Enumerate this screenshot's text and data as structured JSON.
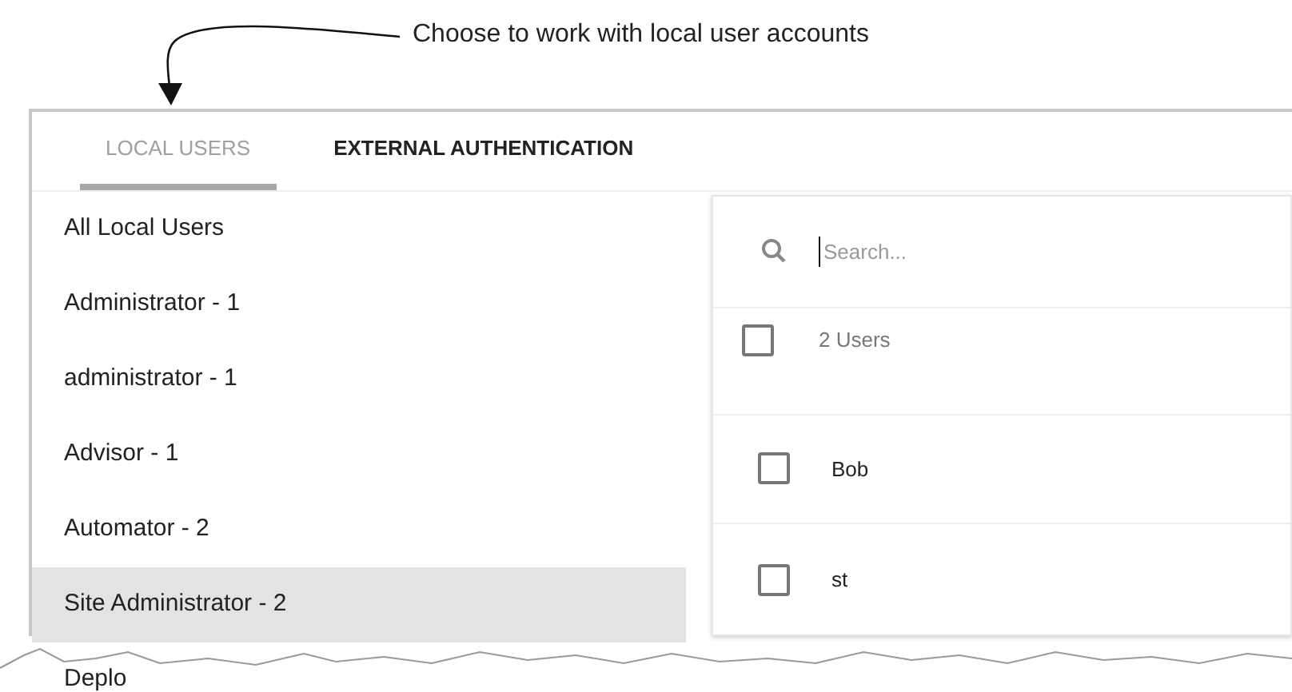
{
  "annotation": {
    "text": "Choose to work with local user accounts"
  },
  "tabs": [
    {
      "label": "LOCAL USERS",
      "selected": true
    },
    {
      "label": "EXTERNAL AUTHENTICATION",
      "selected": false
    }
  ],
  "groups": [
    {
      "label": "All Local Users",
      "selected": false
    },
    {
      "label": "Administrator - 1",
      "selected": false
    },
    {
      "label": "administrator - 1",
      "selected": false
    },
    {
      "label": "Advisor - 1",
      "selected": false
    },
    {
      "label": "Automator - 2",
      "selected": false
    },
    {
      "label": "Site Administrator - 2",
      "selected": true
    },
    {
      "label": "Deplo",
      "selected": false
    }
  ],
  "search": {
    "placeholder": "Search..."
  },
  "header": {
    "label": "2 Users",
    "checked": false
  },
  "users": [
    {
      "name": "Bob",
      "checked": false
    },
    {
      "name": "st",
      "checked": false
    }
  ]
}
